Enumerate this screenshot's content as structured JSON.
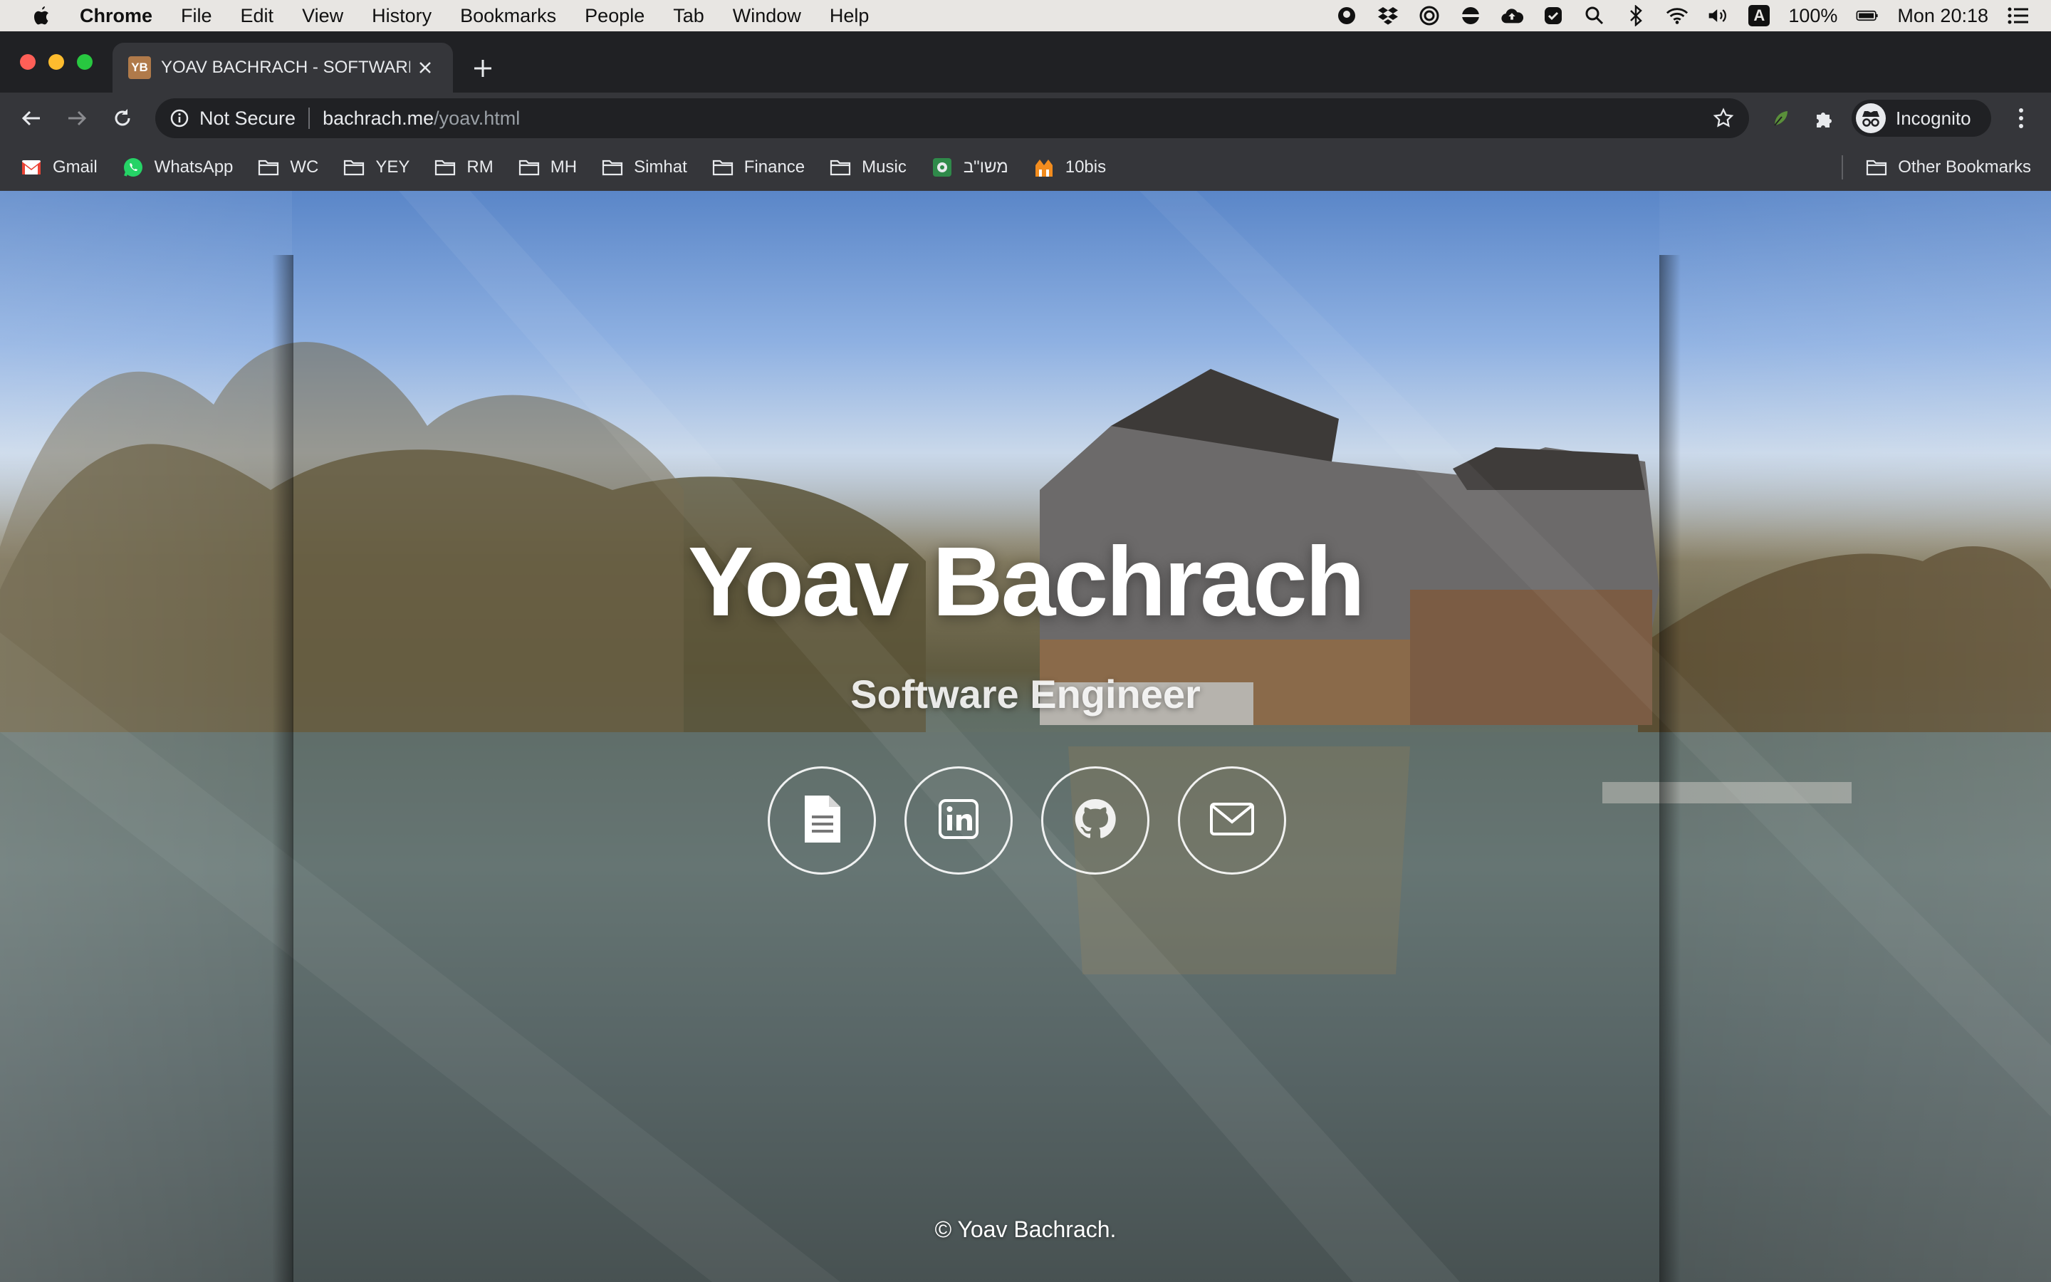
{
  "menubar": {
    "app_name": "Chrome",
    "items": [
      "File",
      "Edit",
      "View",
      "History",
      "Bookmarks",
      "People",
      "Tab",
      "Window",
      "Help"
    ],
    "battery": "100%",
    "clock": "Mon 20:18",
    "input_source": "A"
  },
  "tab": {
    "favicon_text": "YB",
    "title": "YOAV BACHRACH - SOFTWARE ENGINEER"
  },
  "omnibox": {
    "security": "Not Secure",
    "host": "bachrach.me",
    "path": "/yoav.html"
  },
  "profile": {
    "label": "Incognito"
  },
  "bookmarks": {
    "items": [
      {
        "label": "Gmail",
        "icon": "gmail-icon"
      },
      {
        "label": "WhatsApp",
        "icon": "whatsapp-icon"
      },
      {
        "label": "WC",
        "icon": "folder-icon"
      },
      {
        "label": "YEY",
        "icon": "folder-icon"
      },
      {
        "label": "RM",
        "icon": "folder-icon"
      },
      {
        "label": "MH",
        "icon": "folder-icon"
      },
      {
        "label": "Simhat",
        "icon": "folder-icon"
      },
      {
        "label": "Finance",
        "icon": "folder-icon"
      },
      {
        "label": "Music",
        "icon": "folder-icon"
      },
      {
        "label": "משו\"ב",
        "icon": "site-icon"
      },
      {
        "label": "10bis",
        "icon": "10bis-icon"
      }
    ],
    "other": "Other Bookmarks"
  },
  "hero": {
    "name": "Yoav Bachrach",
    "role": "Software Engineer",
    "links": [
      {
        "name": "resume-link",
        "icon": "document-icon"
      },
      {
        "name": "linkedin-link",
        "icon": "linkedin-icon"
      },
      {
        "name": "github-link",
        "icon": "github-icon"
      },
      {
        "name": "email-link",
        "icon": "envelope-icon"
      }
    ]
  },
  "footer": {
    "copyright": "© Yoav Bachrach."
  },
  "colors": {
    "tabstrip": "#202124",
    "toolbar": "#35363a",
    "menubar": "#e8e6e3",
    "hero_text": "#ffffff"
  }
}
